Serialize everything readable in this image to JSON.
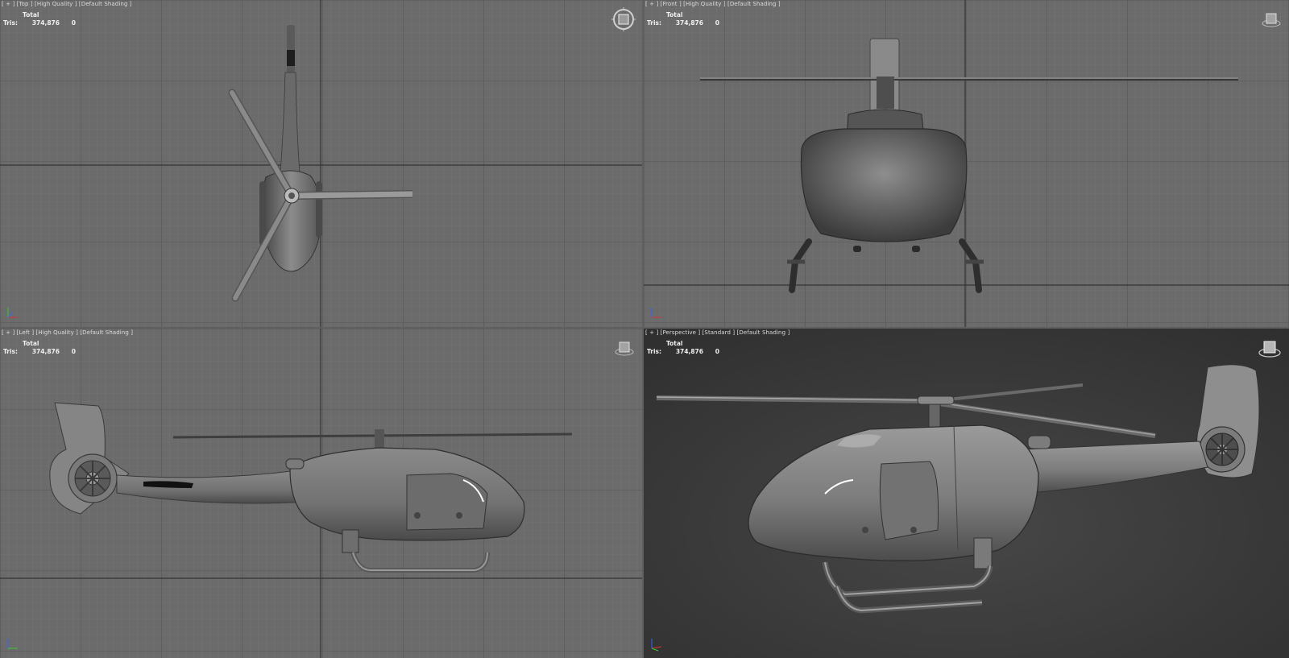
{
  "app": {
    "accent_active_border": "#c8a23a"
  },
  "viewports": {
    "top": {
      "label_parts": [
        "[ + ]",
        "[Top ]",
        "[High Quality ]",
        "[Default Shading ]"
      ]
    },
    "front": {
      "label_parts": [
        "[ + ]",
        "[Front ]",
        "[High Quality ]",
        "[Default Shading ]"
      ]
    },
    "left": {
      "label_parts": [
        "[ + ]",
        "[Left ]",
        "[High Quality ]",
        "[Default Shading ]"
      ]
    },
    "persp": {
      "label_parts": [
        "[ + ]",
        "[Perspective ]",
        "[Standard ]",
        "[Default Shading ]"
      ]
    }
  },
  "stats": {
    "header": "Total",
    "label": "Tris:",
    "value": "374,876",
    "selected": "0"
  },
  "icons": {
    "viewcube_top": "viewcube-top-icon",
    "viewcube": "viewcube-icon",
    "axis": "axis-tripod-icon"
  }
}
